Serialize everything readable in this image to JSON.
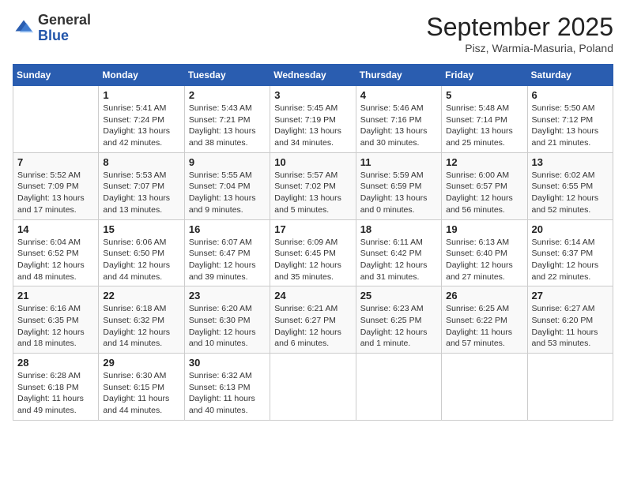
{
  "header": {
    "logo_general": "General",
    "logo_blue": "Blue",
    "month": "September 2025",
    "location": "Pisz, Warmia-Masuria, Poland"
  },
  "weekdays": [
    "Sunday",
    "Monday",
    "Tuesday",
    "Wednesday",
    "Thursday",
    "Friday",
    "Saturday"
  ],
  "weeks": [
    [
      {
        "date": "",
        "info": ""
      },
      {
        "date": "1",
        "info": "Sunrise: 5:41 AM\nSunset: 7:24 PM\nDaylight: 13 hours\nand 42 minutes."
      },
      {
        "date": "2",
        "info": "Sunrise: 5:43 AM\nSunset: 7:21 PM\nDaylight: 13 hours\nand 38 minutes."
      },
      {
        "date": "3",
        "info": "Sunrise: 5:45 AM\nSunset: 7:19 PM\nDaylight: 13 hours\nand 34 minutes."
      },
      {
        "date": "4",
        "info": "Sunrise: 5:46 AM\nSunset: 7:16 PM\nDaylight: 13 hours\nand 30 minutes."
      },
      {
        "date": "5",
        "info": "Sunrise: 5:48 AM\nSunset: 7:14 PM\nDaylight: 13 hours\nand 25 minutes."
      },
      {
        "date": "6",
        "info": "Sunrise: 5:50 AM\nSunset: 7:12 PM\nDaylight: 13 hours\nand 21 minutes."
      }
    ],
    [
      {
        "date": "7",
        "info": "Sunrise: 5:52 AM\nSunset: 7:09 PM\nDaylight: 13 hours\nand 17 minutes."
      },
      {
        "date": "8",
        "info": "Sunrise: 5:53 AM\nSunset: 7:07 PM\nDaylight: 13 hours\nand 13 minutes."
      },
      {
        "date": "9",
        "info": "Sunrise: 5:55 AM\nSunset: 7:04 PM\nDaylight: 13 hours\nand 9 minutes."
      },
      {
        "date": "10",
        "info": "Sunrise: 5:57 AM\nSunset: 7:02 PM\nDaylight: 13 hours\nand 5 minutes."
      },
      {
        "date": "11",
        "info": "Sunrise: 5:59 AM\nSunset: 6:59 PM\nDaylight: 13 hours\nand 0 minutes."
      },
      {
        "date": "12",
        "info": "Sunrise: 6:00 AM\nSunset: 6:57 PM\nDaylight: 12 hours\nand 56 minutes."
      },
      {
        "date": "13",
        "info": "Sunrise: 6:02 AM\nSunset: 6:55 PM\nDaylight: 12 hours\nand 52 minutes."
      }
    ],
    [
      {
        "date": "14",
        "info": "Sunrise: 6:04 AM\nSunset: 6:52 PM\nDaylight: 12 hours\nand 48 minutes."
      },
      {
        "date": "15",
        "info": "Sunrise: 6:06 AM\nSunset: 6:50 PM\nDaylight: 12 hours\nand 44 minutes."
      },
      {
        "date": "16",
        "info": "Sunrise: 6:07 AM\nSunset: 6:47 PM\nDaylight: 12 hours\nand 39 minutes."
      },
      {
        "date": "17",
        "info": "Sunrise: 6:09 AM\nSunset: 6:45 PM\nDaylight: 12 hours\nand 35 minutes."
      },
      {
        "date": "18",
        "info": "Sunrise: 6:11 AM\nSunset: 6:42 PM\nDaylight: 12 hours\nand 31 minutes."
      },
      {
        "date": "19",
        "info": "Sunrise: 6:13 AM\nSunset: 6:40 PM\nDaylight: 12 hours\nand 27 minutes."
      },
      {
        "date": "20",
        "info": "Sunrise: 6:14 AM\nSunset: 6:37 PM\nDaylight: 12 hours\nand 22 minutes."
      }
    ],
    [
      {
        "date": "21",
        "info": "Sunrise: 6:16 AM\nSunset: 6:35 PM\nDaylight: 12 hours\nand 18 minutes."
      },
      {
        "date": "22",
        "info": "Sunrise: 6:18 AM\nSunset: 6:32 PM\nDaylight: 12 hours\nand 14 minutes."
      },
      {
        "date": "23",
        "info": "Sunrise: 6:20 AM\nSunset: 6:30 PM\nDaylight: 12 hours\nand 10 minutes."
      },
      {
        "date": "24",
        "info": "Sunrise: 6:21 AM\nSunset: 6:27 PM\nDaylight: 12 hours\nand 6 minutes."
      },
      {
        "date": "25",
        "info": "Sunrise: 6:23 AM\nSunset: 6:25 PM\nDaylight: 12 hours\nand 1 minute."
      },
      {
        "date": "26",
        "info": "Sunrise: 6:25 AM\nSunset: 6:22 PM\nDaylight: 11 hours\nand 57 minutes."
      },
      {
        "date": "27",
        "info": "Sunrise: 6:27 AM\nSunset: 6:20 PM\nDaylight: 11 hours\nand 53 minutes."
      }
    ],
    [
      {
        "date": "28",
        "info": "Sunrise: 6:28 AM\nSunset: 6:18 PM\nDaylight: 11 hours\nand 49 minutes."
      },
      {
        "date": "29",
        "info": "Sunrise: 6:30 AM\nSunset: 6:15 PM\nDaylight: 11 hours\nand 44 minutes."
      },
      {
        "date": "30",
        "info": "Sunrise: 6:32 AM\nSunset: 6:13 PM\nDaylight: 11 hours\nand 40 minutes."
      },
      {
        "date": "",
        "info": ""
      },
      {
        "date": "",
        "info": ""
      },
      {
        "date": "",
        "info": ""
      },
      {
        "date": "",
        "info": ""
      }
    ]
  ]
}
